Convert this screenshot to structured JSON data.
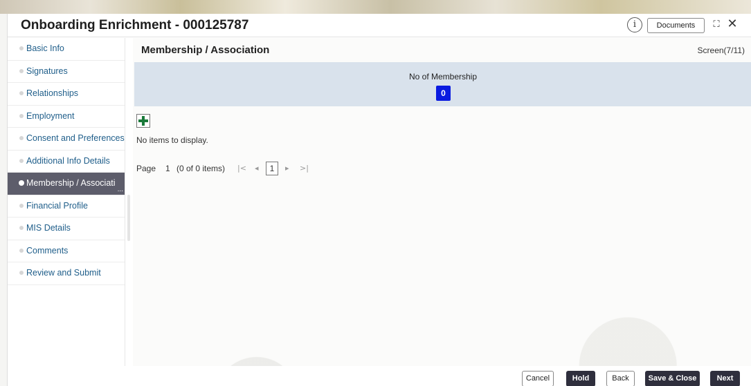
{
  "header": {
    "title": "Onboarding Enrichment - 000125787",
    "info_icon": "info-circle-icon",
    "documents_label": "Documents",
    "expand_icon": "expand-icon",
    "close_icon": "close-icon"
  },
  "sidebar": {
    "items": [
      {
        "label": "Basic Info",
        "active": false
      },
      {
        "label": "Signatures",
        "active": false
      },
      {
        "label": "Relationships",
        "active": false
      },
      {
        "label": "Employment",
        "active": false
      },
      {
        "label": "Consent and Preferences",
        "active": false
      },
      {
        "label": "Additional Info Details",
        "active": false
      },
      {
        "label": "Membership / Associati",
        "active": true
      },
      {
        "label": "Financial Profile",
        "active": false
      },
      {
        "label": "MIS Details",
        "active": false
      },
      {
        "label": "Comments",
        "active": false
      },
      {
        "label": "Review and Submit",
        "active": false
      }
    ],
    "active_overflow": "..."
  },
  "main": {
    "section_title": "Membership / Association",
    "screen_indicator": "Screen(7/11)",
    "stats_label": "No of Membership",
    "stats_value": "0",
    "empty_message": "No items to display.",
    "pager": {
      "page_label": "Page",
      "page_number": "1",
      "items_summary": "(0 of 0 items)",
      "first_glyph": "|<",
      "prev_glyph": "◂",
      "current_page": "1",
      "next_glyph": "▸",
      "last_glyph": ">|"
    }
  },
  "footer": {
    "cancel_label": "Cancel",
    "hold_label": "Hold",
    "back_label": "Back",
    "save_close_label": "Save & Close",
    "next_label": "Next"
  },
  "colors": {
    "accent_blue": "#0a1be0",
    "band": "#d9e2ec",
    "active_nav": "#5d5d6b",
    "link": "#1f5e8a",
    "dark_button": "#2f2f3d",
    "add_icon": "#1a7a3a"
  }
}
